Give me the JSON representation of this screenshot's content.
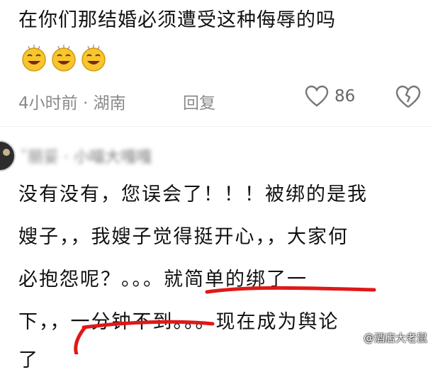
{
  "comment": {
    "text": "在你们那结婚必须遭受这种侮辱的吗",
    "emoji_icons": [
      "grin-emoji-icon",
      "grin-emoji-icon",
      "grin-emoji-icon"
    ],
    "time": "4小时前 · 湖南",
    "reply_label": "回复",
    "like_count": "86"
  },
  "reply": {
    "username": "ˇ丽妥 · 小喵大嘎嘎",
    "lines": [
      "没有没有，您误会了！！！被绑的是我",
      "嫂子，，我嫂子觉得挺开心，，大家何",
      "必抱怨呢？。。。就简单的绑了一",
      "下，，一分钟不到。。。现在成为舆论",
      "了"
    ]
  },
  "watermark": "@酒店大老鼠",
  "colors": {
    "annotation": "#e01818",
    "meta_text": "#8a8a8a",
    "emoji_face": "#f7c52e"
  }
}
